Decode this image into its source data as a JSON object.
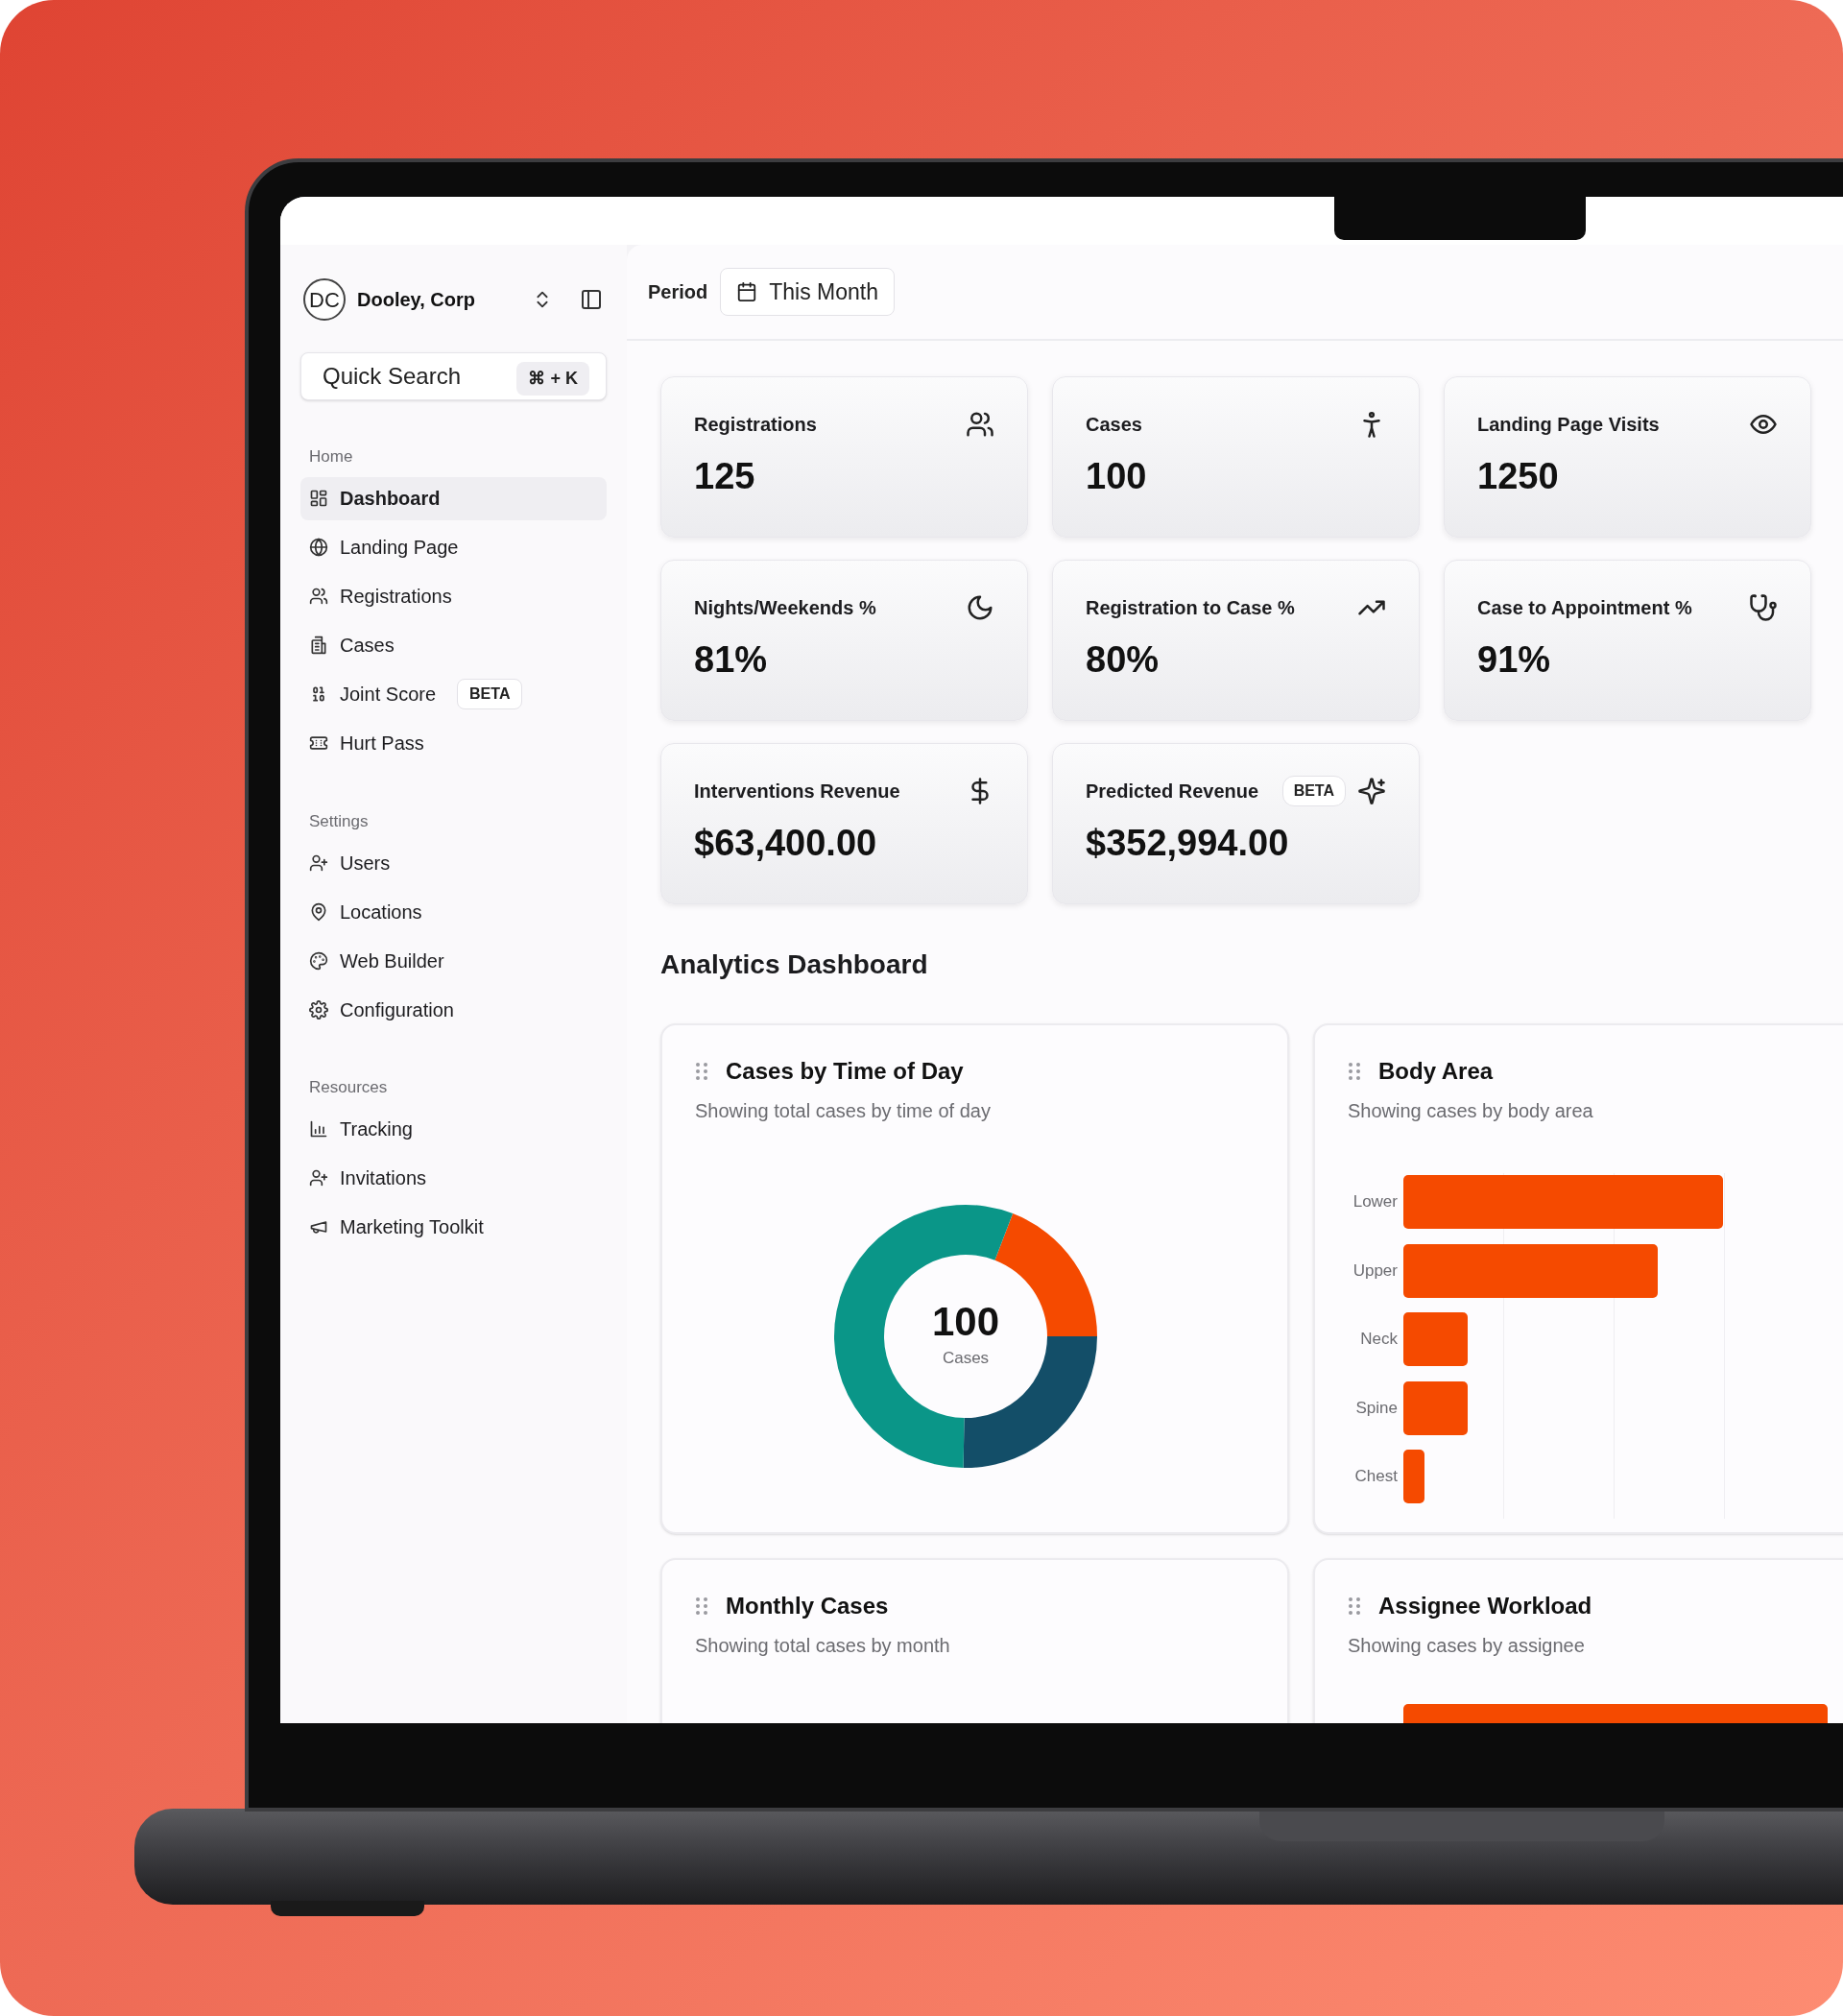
{
  "workspace": {
    "initials": "DC",
    "name": "Dooley, Corp"
  },
  "quick_search": {
    "placeholder": "Quick Search",
    "shortcut": "⌘ + K"
  },
  "sidebar": {
    "sections": [
      {
        "title": "Home",
        "items": [
          {
            "label": "Dashboard",
            "selected": true
          },
          {
            "label": "Landing Page",
            "selected": false
          },
          {
            "label": "Registrations",
            "selected": false
          },
          {
            "label": "Cases",
            "selected": false
          },
          {
            "label": "Joint Score",
            "badge": "BETA",
            "selected": false
          },
          {
            "label": "Hurt Pass",
            "selected": false
          }
        ]
      },
      {
        "title": "Settings",
        "items": [
          {
            "label": "Users",
            "selected": false
          },
          {
            "label": "Locations",
            "selected": false
          },
          {
            "label": "Web Builder",
            "selected": false
          },
          {
            "label": "Configuration",
            "selected": false
          }
        ]
      },
      {
        "title": "Resources",
        "items": [
          {
            "label": "Tracking",
            "selected": false
          },
          {
            "label": "Invitations",
            "selected": false
          },
          {
            "label": "Marketing Toolkit",
            "selected": false
          }
        ]
      }
    ]
  },
  "header": {
    "period_label": "Period",
    "period_value": "This Month"
  },
  "stats": [
    {
      "label": "Registrations",
      "value": "125"
    },
    {
      "label": "Cases",
      "value": "100"
    },
    {
      "label": "Landing Page Visits",
      "value": "1250"
    },
    {
      "label": "Nights/Weekends %",
      "value": "81%"
    },
    {
      "label": "Registration to Case %",
      "value": "80%"
    },
    {
      "label": "Case to Appointment %",
      "value": "91%"
    },
    {
      "label": "Interventions Revenue",
      "value": "$63,400.00"
    },
    {
      "label": "Predicted Revenue",
      "badge": "BETA",
      "value": "$352,994.00"
    }
  ],
  "section_title": "Analytics Dashboard",
  "charts": [
    {
      "kind": "donut",
      "title": "Cases by Time of Day",
      "subtitle": "Showing total cases by time of day",
      "center_value": "100",
      "center_label": "Cases"
    },
    {
      "kind": "hbar",
      "title": "Body Area",
      "subtitle": "Showing cases by body area",
      "categories": [
        "Lower",
        "Upper",
        "Neck",
        "Spine",
        "Chest"
      ]
    },
    {
      "kind": "baseline",
      "title": "Monthly Cases",
      "subtitle": "Showing total cases by month"
    },
    {
      "kind": "cutbar",
      "title": "Assignee Workload",
      "subtitle": "Showing cases by assignee"
    }
  ]
}
